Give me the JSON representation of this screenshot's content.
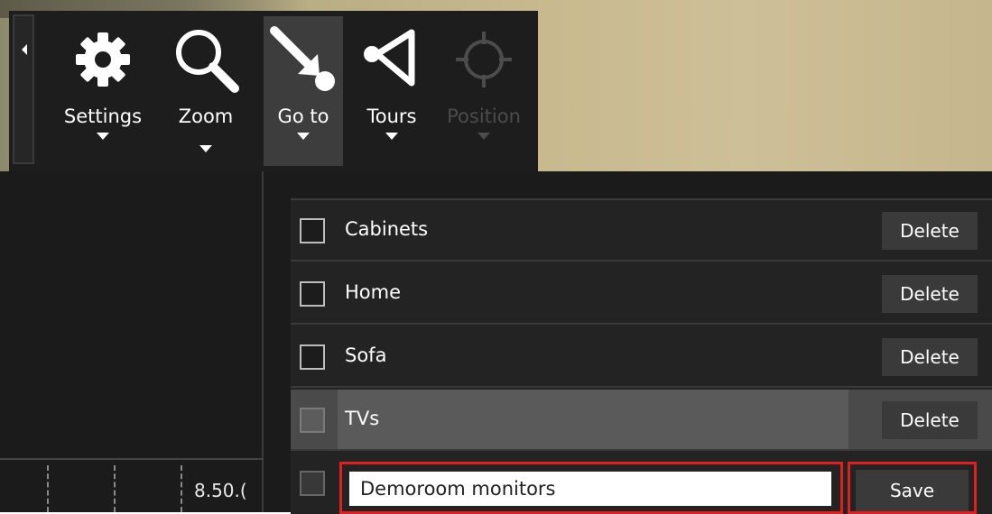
{
  "toolbar": {
    "tools": [
      {
        "label": "Settings",
        "icon": "gear-icon"
      },
      {
        "label": "Zoom",
        "icon": "magnifier-icon"
      },
      {
        "label": "Go to",
        "icon": "goto-arrow-icon",
        "active": true
      },
      {
        "label": "Tours",
        "icon": "tours-icon"
      },
      {
        "label": "Position",
        "icon": "crosshair-icon",
        "disabled": true
      }
    ]
  },
  "timeline": {
    "label": "8.50.("
  },
  "goto_menu": {
    "presets": [
      {
        "name": "Cabinets",
        "action": "Delete"
      },
      {
        "name": "Home",
        "action": "Delete"
      },
      {
        "name": "Sofa",
        "action": "Delete"
      },
      {
        "name": "TVs",
        "action": "Delete",
        "selected": true
      }
    ],
    "new_preset": {
      "value": "Demoroom monitors",
      "action": "Save"
    }
  },
  "colors": {
    "highlight": "#e02020",
    "toolbar_bg": "#1d1d1d",
    "panel_bg": "#232323"
  }
}
